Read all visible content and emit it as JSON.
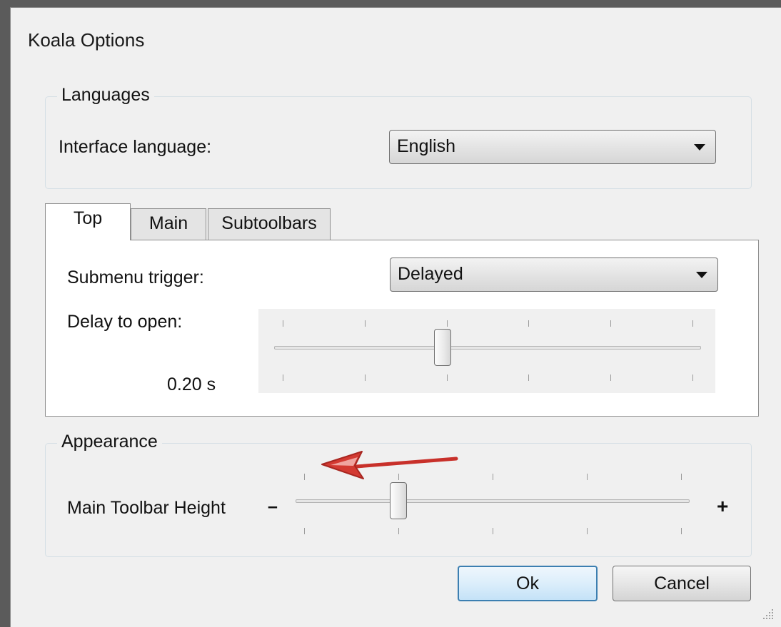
{
  "window": {
    "title": "Koala Options"
  },
  "languages": {
    "legend": "Languages",
    "interface_language_label": "Interface language:",
    "interface_language_value": "English"
  },
  "tabs": [
    {
      "label": "Top",
      "active": true
    },
    {
      "label": "Main",
      "active": false
    },
    {
      "label": "Subtoolbars",
      "active": false
    }
  ],
  "top_tab": {
    "submenu_trigger_label": "Submenu trigger:",
    "submenu_trigger_value": "Delayed",
    "delay_label": "Delay to open:",
    "delay_value_text": "0.20 s",
    "delay_slider": {
      "ticks": 6,
      "position_fraction": 0.39
    }
  },
  "appearance": {
    "legend": "Appearance",
    "toolbar_height_label": "Main Toolbar Height",
    "minus": "–",
    "plus": "+",
    "toolbar_slider": {
      "ticks": 5,
      "position_fraction": 0.25
    }
  },
  "buttons": {
    "ok": "Ok",
    "cancel": "Cancel"
  },
  "colors": {
    "dialog_bg": "#f0f0f0",
    "default_button_border": "#3c7fb1",
    "annotation_arrow": "#c8302a"
  },
  "icons": [
    "dropdown-arrow-icon",
    "annotation-arrow-icon",
    "resize-grip-icon"
  ]
}
